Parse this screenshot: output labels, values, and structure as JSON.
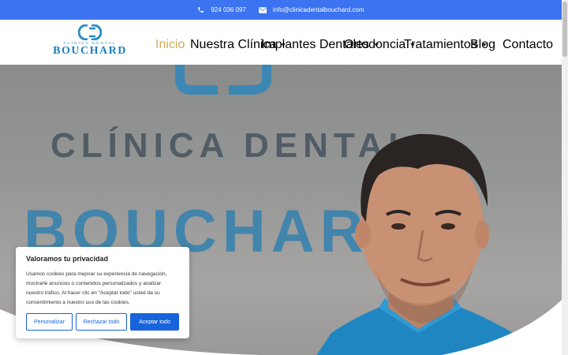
{
  "topbar": {
    "phone": "924 036 097",
    "email": "info@clinicadentalbouchard.com",
    "phone_icon": "phone-icon",
    "email_icon": "envelope-icon"
  },
  "logo": {
    "small": "CLÍNICA DENTAL",
    "big": "BOUCHARD"
  },
  "nav": {
    "items": [
      {
        "label": "Inicio",
        "active": true,
        "dropdown": false
      },
      {
        "label": "Nuestra Clínica",
        "active": false,
        "dropdown": true
      },
      {
        "label": "Implantes Dentales",
        "active": false,
        "dropdown": true
      },
      {
        "label": "Ortodoncia",
        "active": false,
        "dropdown": true
      },
      {
        "label": "Tratamientos",
        "active": false,
        "dropdown": true
      },
      {
        "label": "Blog",
        "active": false,
        "dropdown": false
      },
      {
        "label": "Contacto",
        "active": false,
        "dropdown": false
      }
    ]
  },
  "hero": {
    "wall_text_1": "CLÍNICA DENTAL",
    "wall_text_2": "BOUCHARD"
  },
  "cookie": {
    "title": "Valoramos tu privacidad",
    "body": "Usamos cookies para mejorar su experiencia de navegación, mostrarle anuncios o contenidos personalizados y analizar nuestro tráfico. Al hacer clic en \"Aceptar todo\" usted da su consentimiento a nuestro uso de las cookies.",
    "btn_customize": "Personalizar",
    "btn_reject": "Rechazar todo",
    "btn_accept": "Aceptar todo"
  },
  "colors": {
    "topbar": "#3b73f0",
    "active_nav": "#d4ac55",
    "brand_blue": "#1a7fbf",
    "button_blue": "#1863dc"
  }
}
